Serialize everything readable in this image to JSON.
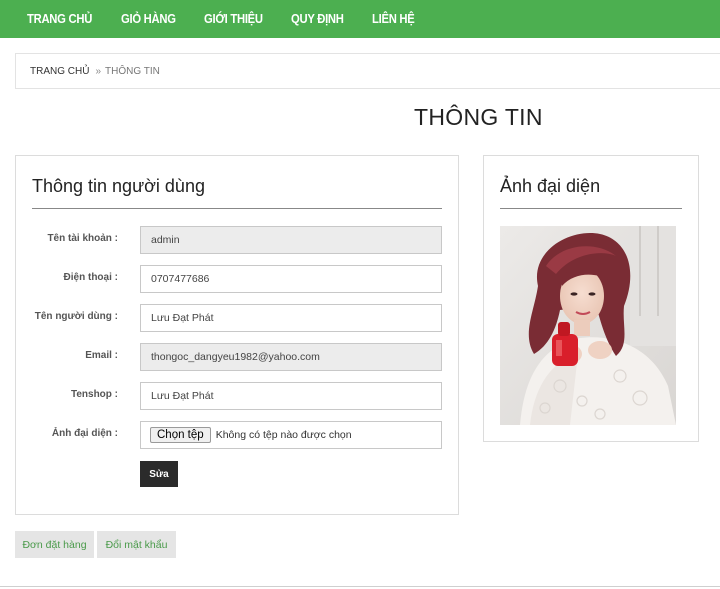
{
  "nav": {
    "items": [
      {
        "label": "TRANG CHỦ"
      },
      {
        "label": "GIỎ HÀNG"
      },
      {
        "label": "GIỚI THIỆU"
      },
      {
        "label": "QUY ĐỊNH"
      },
      {
        "label": "LIÊN HỆ"
      }
    ],
    "bg_color": "#4caf50"
  },
  "breadcrumb": {
    "home": "TRANG CHỦ",
    "separator": "»",
    "current": "THÔNG TIN"
  },
  "page_title": "THÔNG TIN",
  "user_panel": {
    "title": "Thông tin người dùng",
    "fields": [
      {
        "label": "Tên tài khoản :",
        "value": "admin",
        "readonly": true
      },
      {
        "label": "Điện thoại :",
        "value": "0707477686",
        "readonly": false
      },
      {
        "label": "Tên người dùng :",
        "value": "Lưu Đạt Phát",
        "readonly": false
      },
      {
        "label": "Email :",
        "value": "thongoc_dangyeu1982@yahoo.com",
        "readonly": true
      },
      {
        "label": "Tenshop :",
        "value": "Lưu Đạt Phát",
        "readonly": false
      }
    ],
    "avatar_field": {
      "label": "Ảnh đại diện :",
      "button_label": "Chọn tệp",
      "status": "Không có tệp nào được chọn"
    },
    "submit_label": "Sửa"
  },
  "avatar_panel": {
    "title": "Ảnh đại diện"
  },
  "tabs": {
    "orders": "Đơn đặt hàng",
    "password": "Đổi mật khẩu"
  }
}
